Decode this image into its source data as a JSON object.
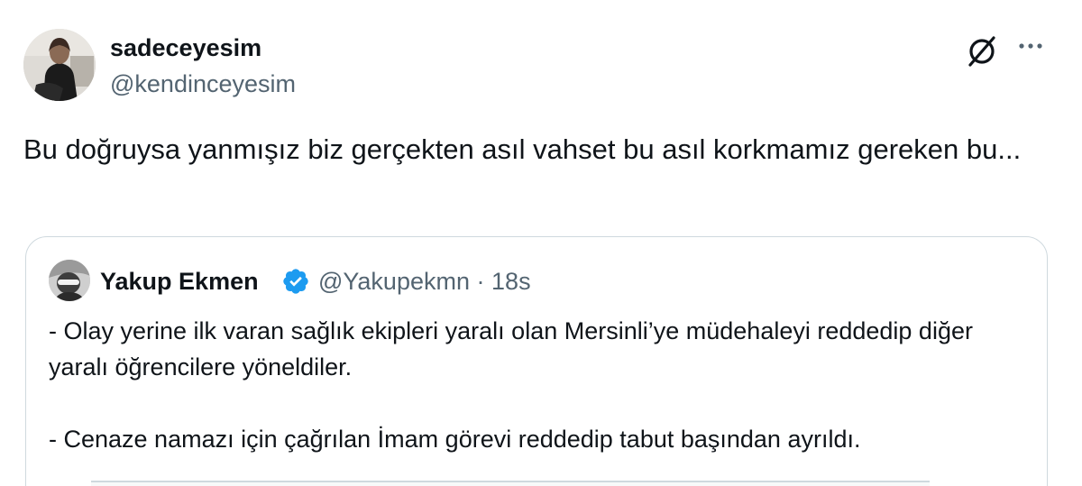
{
  "tweet": {
    "author": {
      "display_name": "sadeceyesim",
      "handle": "@kendinceyesim",
      "avatar_icon": "user-avatar"
    },
    "text": "Bu doğruysa yanmışız biz gerçekten asıl vahset bu asıl korkmamız gereken bu...",
    "actions": {
      "grok_icon": "slashed-circle-icon",
      "more_icon": "ellipsis-icon"
    }
  },
  "quoted_tweet": {
    "author": {
      "display_name": "Yakup Ekmen",
      "verified": true,
      "verified_color": "#1d9bf0",
      "handle": "@Yakupekmn",
      "separator": "·",
      "time": "18s"
    },
    "paragraphs": [
      "- Olay yerine ilk varan sağlık ekipleri yaralı olan Mersinli’ye müdehaleyi reddedip diğer yaralı öğrencilere yöneldiler.",
      "- Cenaze namazı için çağrılan İmam görevi reddedip tabut başından ayrıldı."
    ]
  },
  "colors": {
    "text_primary": "#0f1419",
    "text_secondary": "#536471",
    "border": "#cfd9de",
    "accent": "#1d9bf0"
  }
}
